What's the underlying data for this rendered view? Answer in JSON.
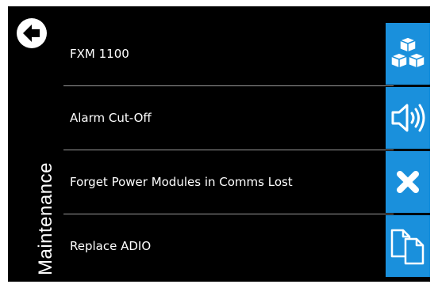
{
  "sidebar": {
    "title": "Maintenance",
    "back_icon": "arrow-left-circle-icon"
  },
  "items": [
    {
      "label": "FXM 1100",
      "icon": "modules-cubes-icon"
    },
    {
      "label": "Alarm Cut-Off",
      "icon": "speaker-icon"
    },
    {
      "label": "Forget Power Modules in Comms Lost",
      "icon": "close-x-icon"
    },
    {
      "label": "Replace ADIO",
      "icon": "copy-documents-icon"
    }
  ],
  "colors": {
    "background": "#000000",
    "accent": "#1a90dc",
    "text": "#ffffff",
    "divider": "#9a9a9a"
  }
}
